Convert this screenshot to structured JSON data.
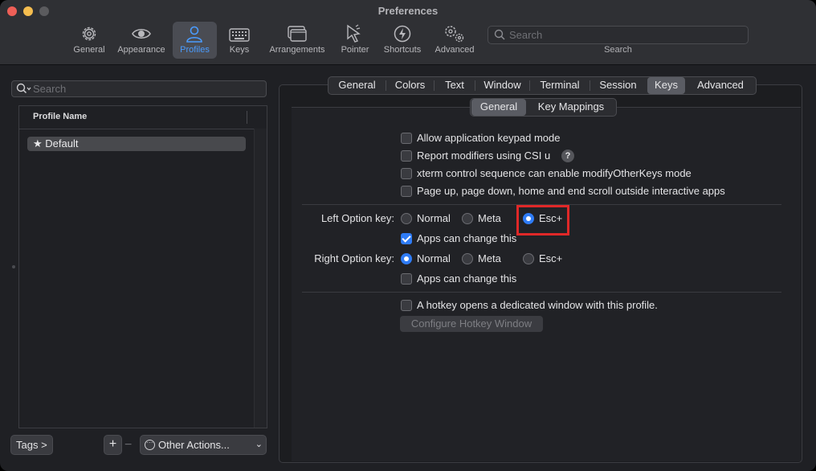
{
  "window": {
    "title": "Preferences"
  },
  "toolbar": {
    "items": [
      {
        "label": "General",
        "icon": "gear-icon"
      },
      {
        "label": "Appearance",
        "icon": "eye-icon"
      },
      {
        "label": "Profiles",
        "icon": "person-icon",
        "selected": true
      },
      {
        "label": "Keys",
        "icon": "keyboard-icon"
      },
      {
        "label": "Arrangements",
        "icon": "windows-stack-icon"
      },
      {
        "label": "Pointer",
        "icon": "pointer-icon"
      },
      {
        "label": "Shortcuts",
        "icon": "lightning-icon"
      },
      {
        "label": "Advanced",
        "icon": "gears-icon"
      }
    ],
    "search_placeholder": "Search",
    "search_label": "Search"
  },
  "profiles": {
    "search_placeholder": "Search",
    "column_header": "Profile Name",
    "items": [
      {
        "name": "Default",
        "default": true
      }
    ],
    "tags_button": "Tags >",
    "add_button": "+",
    "remove_button": "−",
    "other_actions": "Other Actions..."
  },
  "tabs": {
    "items": [
      "General",
      "Colors",
      "Text",
      "Window",
      "Terminal",
      "Session",
      "Keys",
      "Advanced"
    ],
    "selected": "Keys"
  },
  "subtabs": {
    "items": [
      "General",
      "Key Mappings"
    ],
    "selected": "General"
  },
  "keys": {
    "options": [
      {
        "label": "Allow application keypad mode",
        "checked": false
      },
      {
        "label": "Report modifiers using CSI u",
        "checked": false,
        "help": "?"
      },
      {
        "label": "xterm control sequence can enable modifyOtherKeys mode",
        "checked": false
      },
      {
        "label": "Page up, page down, home and end scroll outside interactive apps",
        "checked": false
      }
    ],
    "left_option": {
      "label": "Left Option key:",
      "choices": [
        "Normal",
        "Meta",
        "Esc+"
      ],
      "selected": "Esc+",
      "apps_can_change": "Apps can change this",
      "apps_can_change_checked": true
    },
    "right_option": {
      "label": "Right Option key:",
      "choices": [
        "Normal",
        "Meta",
        "Esc+"
      ],
      "selected": "Normal",
      "apps_can_change": "Apps can change this",
      "apps_can_change_checked": false
    },
    "hotkey": {
      "label": "A hotkey opens a dedicated window with this profile.",
      "checked": false,
      "configure_button": "Configure Hotkey Window"
    }
  },
  "colors": {
    "accent": "#2f7cf6",
    "selected_tab": "#4a9cff",
    "highlight_box": "#e02828"
  }
}
